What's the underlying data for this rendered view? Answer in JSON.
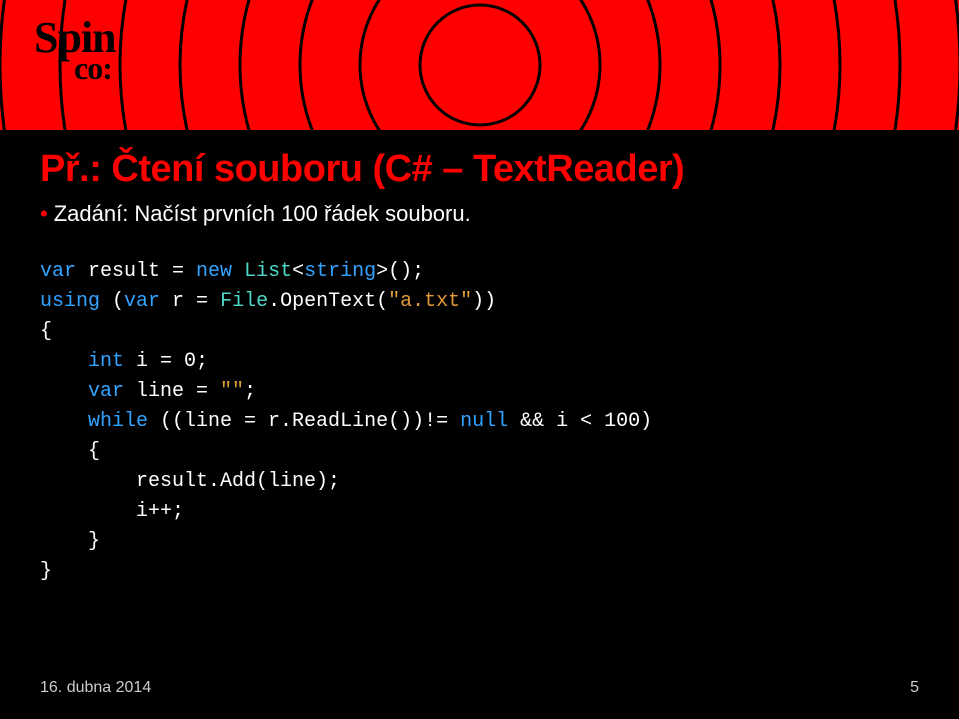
{
  "logo": {
    "line1": "Spin",
    "line2": "co:"
  },
  "title": "Př.: Čtení souboru (C# – TextReader)",
  "subtitle": "Zadání: Načíst prvních 100 řádek souboru.",
  "code": {
    "l1_kw1": "var",
    "l1_txt1": " result = ",
    "l1_kw2": "new",
    "l1_txt2": " ",
    "l1_type": "List",
    "l1_txt3": "<",
    "l1_kw3": "string",
    "l1_txt4": ">();",
    "l2_kw1": "using",
    "l2_txt1": " (",
    "l2_kw2": "var",
    "l2_txt2": " r = ",
    "l2_type": "File",
    "l2_txt3": ".OpenText(",
    "l2_str": "\"a.txt\"",
    "l2_txt4": "))",
    "l3": "{",
    "l4_pad": "    ",
    "l4_kw": "int",
    "l4_txt": " i = 0;",
    "l5_pad": "    ",
    "l5_kw": "var",
    "l5_txt1": " line = ",
    "l5_str": "\"\"",
    "l5_txt2": ";",
    "l6_pad": "    ",
    "l6_kw": "while",
    "l6_txt1": " ((line = r.ReadLine())!= ",
    "l6_kw2": "null",
    "l6_txt2": " && i < 100)",
    "l7": "    {",
    "l8": "        result.Add(line);",
    "l9": "        i++;",
    "l10": "    }",
    "l11": "}"
  },
  "footer": {
    "date": "16. dubna 2014",
    "page": "5"
  }
}
